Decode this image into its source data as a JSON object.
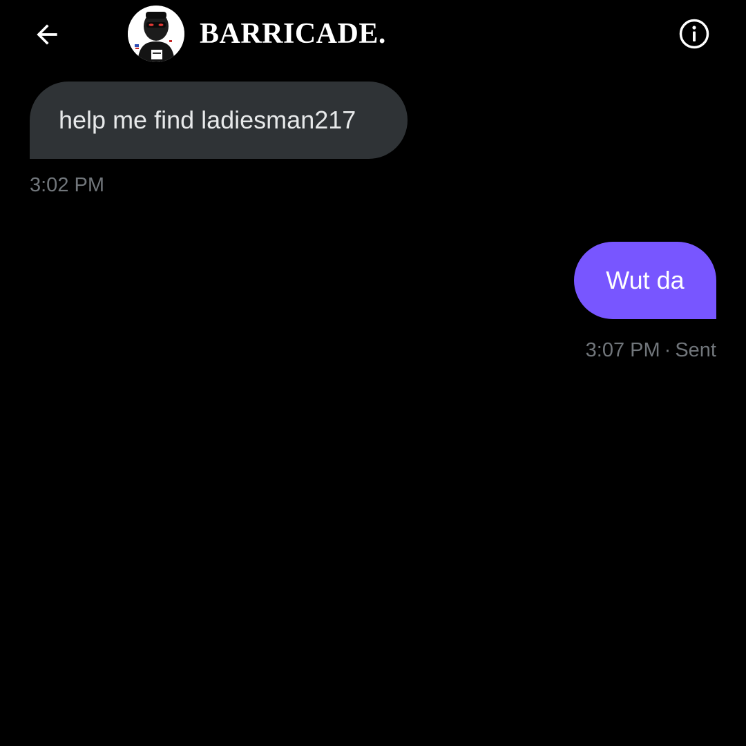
{
  "header": {
    "back_icon": "arrow-left-icon",
    "contact_name": "BARRICADE.",
    "info_icon": "info-circle-icon"
  },
  "messages": [
    {
      "direction": "incoming",
      "text": "help me find ladiesman217",
      "time": "3:02 PM"
    },
    {
      "direction": "outgoing",
      "text": "Wut da",
      "time": "3:07 PM",
      "separator": "·",
      "status": "Sent"
    }
  ],
  "colors": {
    "background": "#000000",
    "incoming_bubble": "#2f3336",
    "outgoing_bubble": "#7856ff",
    "meta_text": "#71767b"
  }
}
